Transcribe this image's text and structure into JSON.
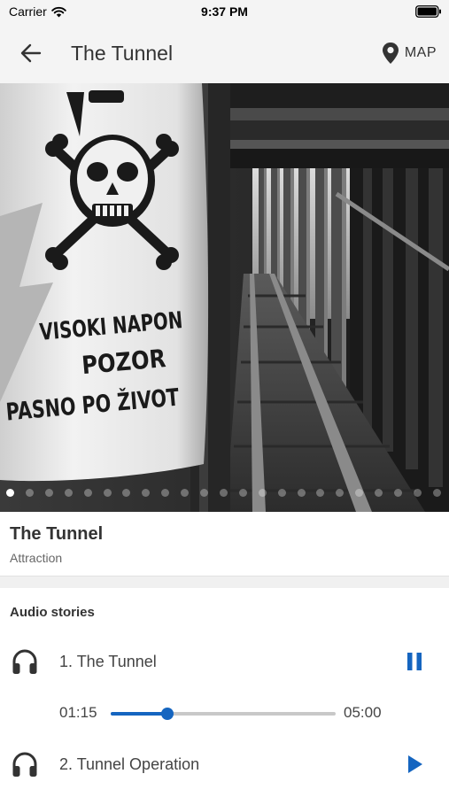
{
  "status_bar": {
    "carrier": "Carrier",
    "time": "9:37 PM"
  },
  "app_bar": {
    "title": "The Tunnel",
    "back_icon": "arrow-left-icon",
    "map_label": "MAP",
    "map_icon": "map-pin-icon"
  },
  "hero": {
    "sign_lines": [
      "VISOKI NAPON",
      "POZOR",
      "PASNO PO ŽIVOT"
    ],
    "slide_count": 23,
    "active_slide": 0
  },
  "place": {
    "title": "The Tunnel",
    "type": "Attraction"
  },
  "audio": {
    "heading": "Audio stories",
    "tracks": [
      {
        "label": "1. The Tunnel",
        "icon": "headphones-icon",
        "action_icon": "pause-icon",
        "state": "playing"
      },
      {
        "label": "2. Tunnel Operation",
        "icon": "headphones-icon",
        "action_icon": "play-icon",
        "state": "stopped"
      }
    ],
    "player": {
      "current": "01:15",
      "total": "05:00",
      "progress": 0.25
    }
  },
  "colors": {
    "accent": "#1565c0",
    "bar_bg": "#f4f4f4",
    "text": "#333333"
  }
}
